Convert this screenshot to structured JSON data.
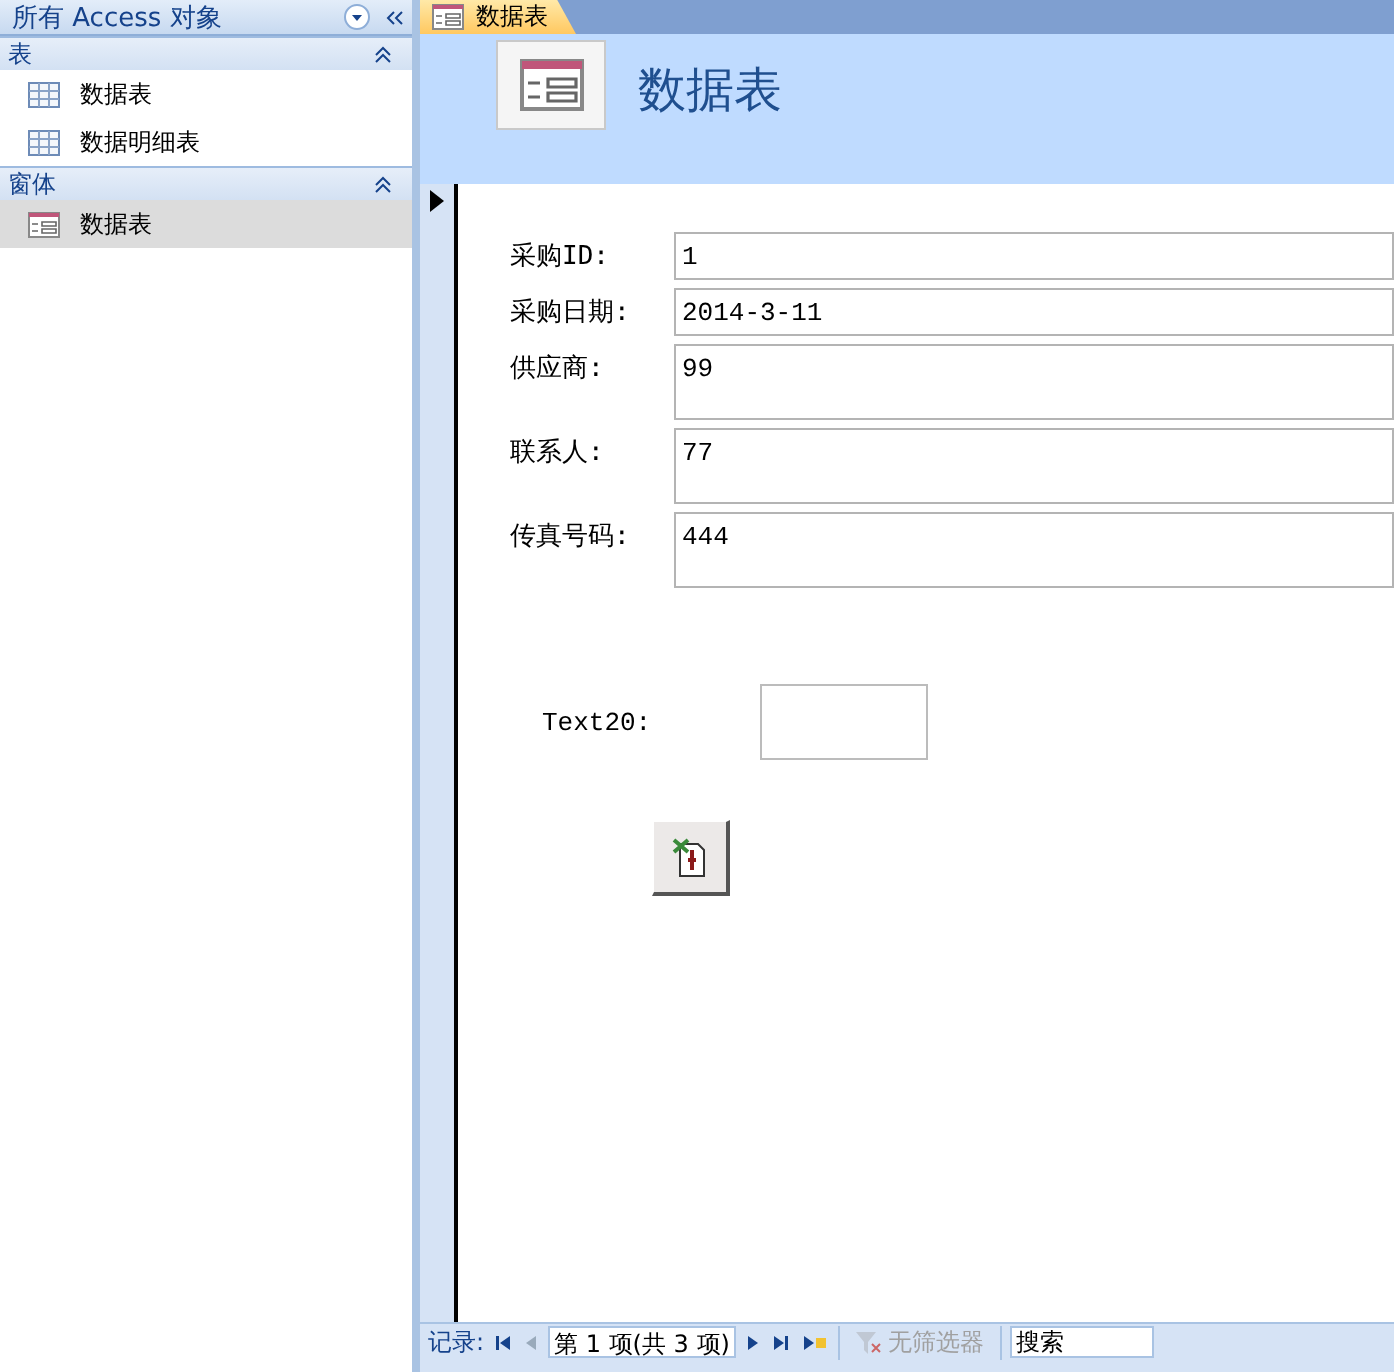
{
  "nav": {
    "title": "所有 Access 对象",
    "groups": [
      {
        "title": "表",
        "expanded": true,
        "items": [
          {
            "label": "数据表",
            "kind": "table",
            "selected": false
          },
          {
            "label": "数据明细表",
            "kind": "table",
            "selected": false
          }
        ]
      },
      {
        "title": "窗体",
        "expanded": true,
        "items": [
          {
            "label": "数据表",
            "kind": "form",
            "selected": true
          }
        ]
      }
    ]
  },
  "tabs": [
    {
      "label": "数据表",
      "selected": true
    }
  ],
  "form": {
    "title": "数据表",
    "fields": [
      {
        "label": "采购ID:",
        "value": "1",
        "kind": "single"
      },
      {
        "label": "采购日期:",
        "value": "2014-3-11",
        "kind": "single"
      },
      {
        "label": "供应商:",
        "value": "99",
        "kind": "multiline"
      },
      {
        "label": "联系人:",
        "value": "77",
        "kind": "multiline"
      },
      {
        "label": "传真号码:",
        "value": "444",
        "kind": "multiline"
      }
    ],
    "unbound_field": {
      "label": "Text20:"
    }
  },
  "status_bar": {
    "label": "记录:",
    "position": "第 1 项(共 3 项)",
    "filter": "无筛选器",
    "search_placeholder": "搜索"
  }
}
